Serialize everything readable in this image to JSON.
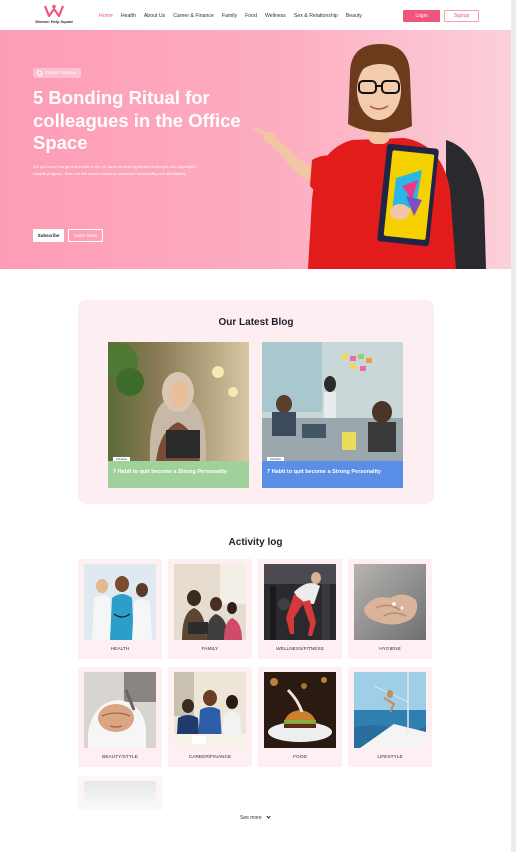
{
  "header": {
    "logo_text": "Women Help Squad",
    "nav": [
      "Home",
      "Health",
      "About Us",
      "Career & Finance",
      "Family",
      "Food",
      "Wellness",
      "Sex & Relationship",
      "Beauty"
    ],
    "login_label": "Login",
    "signup_label": "Signup"
  },
  "hero": {
    "tag": "Career Finance",
    "title": "5 Bonding Ritual for colleagues in the Office Space",
    "description": "Did you know that general health in the UK faces several significant challenges and disparities? Despite progress, there are still issues related to healthcare accessibility and affordability.",
    "subscribe_label": "Subscribe",
    "learn_more_label": "Learn More"
  },
  "blog": {
    "title": "Our Latest Blog",
    "posts": [
      {
        "label": "Lifestyle",
        "title": "7 Habit to quit become a Strong Personality"
      },
      {
        "label": "Lifestyle",
        "title": "7 Habit to quit become a Strong Personality"
      }
    ]
  },
  "activity": {
    "title": "Activity log",
    "tiles": [
      "HEALTH",
      "FAMILY",
      "WELLNESS/FITNESS",
      "HYGIENE",
      "BEAUTY/STYLE",
      "CAREER/FINANCE",
      "FOOD",
      "LIFESTYLE"
    ],
    "see_more": "See more"
  },
  "colors": {
    "accent": "#f0567d",
    "hero_bg": "#fda4ba",
    "card_bg": "#fdeef1",
    "caption_green": "#9fd29a",
    "caption_blue": "#5b8ee6"
  }
}
